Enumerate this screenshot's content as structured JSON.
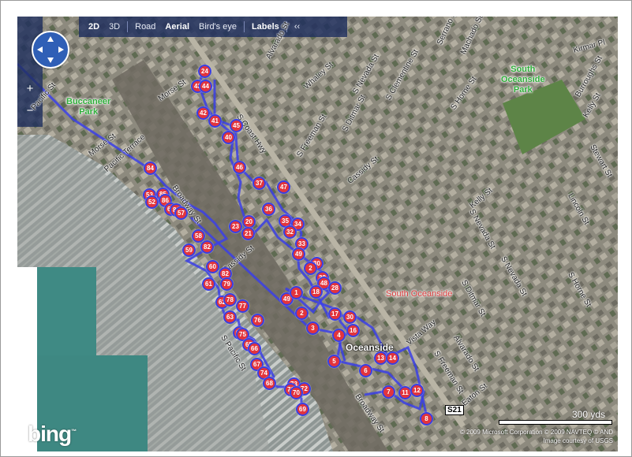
{
  "toolbar": {
    "items": [
      {
        "label": "2D",
        "active": true
      },
      {
        "label": "3D",
        "active": false
      },
      {
        "label": "Road",
        "active": false
      },
      {
        "label": "Aerial",
        "active": true
      },
      {
        "label": "Bird's eye",
        "active": false
      },
      {
        "label": "Labels",
        "active": true
      },
      {
        "label": "‹‹",
        "active": false
      }
    ]
  },
  "zoom": {
    "in": "+",
    "out": "−"
  },
  "labels": {
    "buccaneer": "Buccaneer\nPark",
    "south_oceanside_park": "South\nOceanside\nPark",
    "city": "Oceanside",
    "neighborhood": "South Oceanside",
    "route": "S21"
  },
  "streets": [
    {
      "text": "Pacific St"
    },
    {
      "text": "Morse St"
    },
    {
      "text": "Pacific Terrace"
    },
    {
      "text": "Broadway St"
    },
    {
      "text": "Morse St"
    },
    {
      "text": "Alvarado St"
    },
    {
      "text": "Whaley St"
    },
    {
      "text": "S Nevada St"
    },
    {
      "text": "S Clementine St"
    },
    {
      "text": "S Coast Hwy"
    },
    {
      "text": "S Freeman St"
    },
    {
      "text": "S Ditmar St"
    },
    {
      "text": "Cassidy St"
    },
    {
      "text": "S Horne St"
    },
    {
      "text": "Kelly St"
    },
    {
      "text": "S Nevada St"
    },
    {
      "text": "S Nevada St"
    },
    {
      "text": "S Ditmar St"
    },
    {
      "text": "Lincoln St"
    },
    {
      "text": "S Horne St"
    },
    {
      "text": "Stewart St"
    },
    {
      "text": "Kirmar Pl"
    },
    {
      "text": "Burroughs St"
    },
    {
      "text": "Kelly St"
    },
    {
      "text": "Machado St"
    },
    {
      "text": "Serrano St"
    },
    {
      "text": "Vista Way"
    },
    {
      "text": "Alvarado St"
    },
    {
      "text": "S Freeman St"
    },
    {
      "text": "Eaton St"
    },
    {
      "text": "Broadway St"
    },
    {
      "text": "S Pacific St"
    },
    {
      "text": "Cassidy St"
    }
  ],
  "markers": [
    "1",
    "2",
    "3",
    "4",
    "5",
    "6",
    "7",
    "8",
    "11",
    "12",
    "13",
    "14",
    "15",
    "16",
    "17",
    "18",
    "20",
    "21",
    "23",
    "24",
    "28",
    "30",
    "32",
    "33",
    "34",
    "35",
    "36",
    "37",
    "38",
    "39",
    "40",
    "41",
    "42",
    "43",
    "44",
    "45",
    "46",
    "47",
    "48",
    "49",
    "52",
    "53",
    "56",
    "57",
    "58",
    "59",
    "60",
    "61",
    "62",
    "63",
    "64",
    "65",
    "66",
    "67",
    "68",
    "69",
    "70",
    "71",
    "72",
    "73",
    "74",
    "75",
    "76",
    "77",
    "78",
    "79",
    "80",
    "81",
    "82",
    "84",
    "85",
    "86",
    "87"
  ],
  "colors": {
    "marker_fill": "#e2343c",
    "marker_ring": "#3a3fe0",
    "route_line": "#3b3fe6",
    "park_label": "#2fae3a",
    "toolbar_bg": "#1e2e5e"
  },
  "logo": "bing",
  "scale": "300 yds",
  "credits": {
    "line1": "© 2009 Microsoft Corporation   © 2009 NAVTEQ   © AND",
    "line2": "Image courtesy of USGS"
  }
}
